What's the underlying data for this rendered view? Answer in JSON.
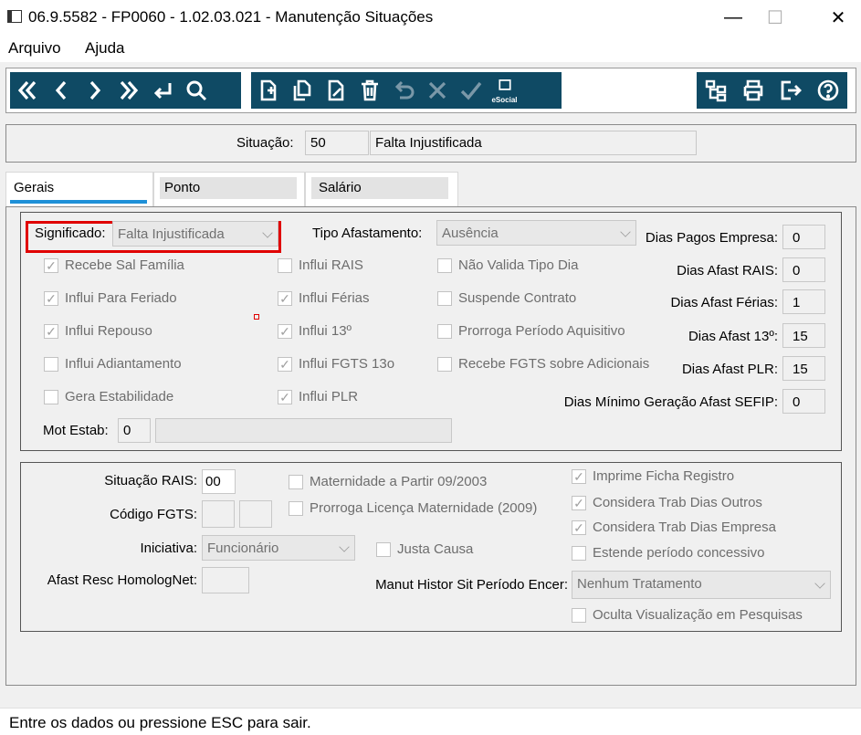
{
  "window": {
    "title": "06.9.5582 - FP0060 - 1.02.03.021 - Manutenção Situações",
    "minimize": "—",
    "maximize": "☐",
    "close": "✕"
  },
  "menu": {
    "items": [
      "Arquivo",
      "Ajuda"
    ]
  },
  "toolbar": {
    "nav": [
      "first",
      "previous",
      "next",
      "last",
      "return",
      "search"
    ],
    "edit": [
      "new",
      "copy",
      "edit",
      "delete",
      "undo",
      "cancel",
      "confirm"
    ],
    "esocial_label": "eSocial",
    "right": [
      "tree",
      "print",
      "exit",
      "help"
    ]
  },
  "situacao": {
    "label": "Situação:",
    "code": "50",
    "description": "Falta Injustificada"
  },
  "tabs": [
    {
      "label": "Gerais",
      "active": true
    },
    {
      "label": "Ponto"
    },
    {
      "label": "Salário"
    }
  ],
  "gerais": {
    "significado": {
      "label": "Significado:",
      "value": "Falta Injustificada"
    },
    "tipo_afastamento": {
      "label": "Tipo Afastamento:",
      "value": "Ausência"
    },
    "checks_col1": [
      {
        "label": "Recebe Sal Família",
        "checked": true
      },
      {
        "label": "Influi Para Feriado",
        "checked": true
      },
      {
        "label": "Influi Repouso",
        "checked": true
      },
      {
        "label": "Influi Adiantamento",
        "checked": false
      },
      {
        "label": "Gera Estabilidade",
        "checked": false
      }
    ],
    "checks_col2": [
      {
        "label": "Influi RAIS",
        "checked": false
      },
      {
        "label": "Influi Férias",
        "checked": true
      },
      {
        "label": "Influi 13º",
        "checked": true
      },
      {
        "label": "Influi FGTS 13o",
        "checked": true
      },
      {
        "label": "Influi PLR",
        "checked": true
      }
    ],
    "checks_col3": [
      {
        "label": "Não Valida Tipo Dia",
        "checked": false
      },
      {
        "label": "Suspende Contrato",
        "checked": false
      },
      {
        "label": "Prorroga Período Aquisitivo",
        "checked": false
      },
      {
        "label": "Recebe FGTS sobre Adicionais",
        "checked": false
      }
    ],
    "dias": [
      {
        "label": "Dias Pagos Empresa:",
        "value": "0"
      },
      {
        "label": "Dias Afast RAIS:",
        "value": "0"
      },
      {
        "label": "Dias Afast Férias:",
        "value": "1"
      },
      {
        "label": "Dias Afast 13º:",
        "value": "15"
      },
      {
        "label": "Dias Afast PLR:",
        "value": "15"
      },
      {
        "label": "Dias Mínimo Geração Afast SEFIP:",
        "value": "0"
      }
    ],
    "mot_estab": {
      "label": "Mot Estab:",
      "code": "0",
      "description": ""
    }
  },
  "lower": {
    "situacao_rais": {
      "label": "Situação RAIS:",
      "value": "00"
    },
    "codigo_fgts": {
      "label": "Código FGTS:",
      "value1": "",
      "value2": ""
    },
    "iniciativa": {
      "label": "Iniciativa:",
      "value": "Funcionário"
    },
    "afast_resc": {
      "label": "Afast Resc HomologNet:",
      "value": ""
    },
    "checks_mid": [
      {
        "label": "Maternidade a Partir 09/2003",
        "checked": false
      },
      {
        "label": "Prorroga Licença Maternidade (2009)",
        "checked": false
      }
    ],
    "justa_causa": {
      "label": "Justa Causa",
      "checked": false
    },
    "checks_right": [
      {
        "label": "Imprime Ficha Registro",
        "checked": true
      },
      {
        "label": "Considera Trab Dias Outros",
        "checked": true
      },
      {
        "label": "Considera Trab Dias Empresa",
        "checked": true
      },
      {
        "label": "Estende período concessivo",
        "checked": false
      }
    ],
    "manut_histor": {
      "label": "Manut Histor Sit Período Encer:",
      "value": "Nenhum Tratamento"
    },
    "oculta": {
      "label": "Oculta Visualização em Pesquisas",
      "checked": false
    }
  },
  "status": {
    "text": "Entre os dados ou pressione ESC para sair."
  },
  "colors": {
    "toolbar_bg": "#0f4a64",
    "highlight_border": "#e00000",
    "tab_accent": "#1e90d8"
  }
}
